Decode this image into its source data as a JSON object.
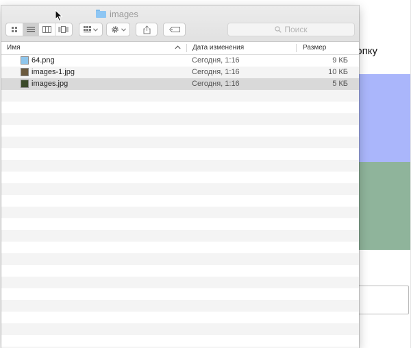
{
  "window": {
    "title": "images"
  },
  "toolbar": {
    "view_buttons": [
      "icon-view",
      "list-view",
      "column-view",
      "cover-flow-view"
    ],
    "active_view": "list-view",
    "arrange_icon": "grid-arrange-icon",
    "action_icon": "gear-icon",
    "share_icon": "share-icon",
    "tag_icon": "tag-icon"
  },
  "search": {
    "placeholder": "Поиск",
    "icon": "magnifier-icon"
  },
  "columns": {
    "name": "Имя",
    "date": "Дата изменения",
    "size": "Размер"
  },
  "files": [
    {
      "name": "64.png",
      "date": "Сегодня, 1:16",
      "size": "9 КБ",
      "thumb_color": "#8fc6ec",
      "selected": false
    },
    {
      "name": "images-1.jpg",
      "date": "Сегодня, 1:16",
      "size": "10 КБ",
      "thumb_color": "#6b5a3e",
      "selected": false
    },
    {
      "name": "images.jpg",
      "date": "Сегодня, 1:16",
      "size": "5 КБ",
      "thumb_color": "#3b4a2a",
      "selected": true
    }
  ],
  "background_page": {
    "visible_text": "нопку",
    "blue_block": "#aab6fb",
    "green_block": "#8fb49b"
  }
}
